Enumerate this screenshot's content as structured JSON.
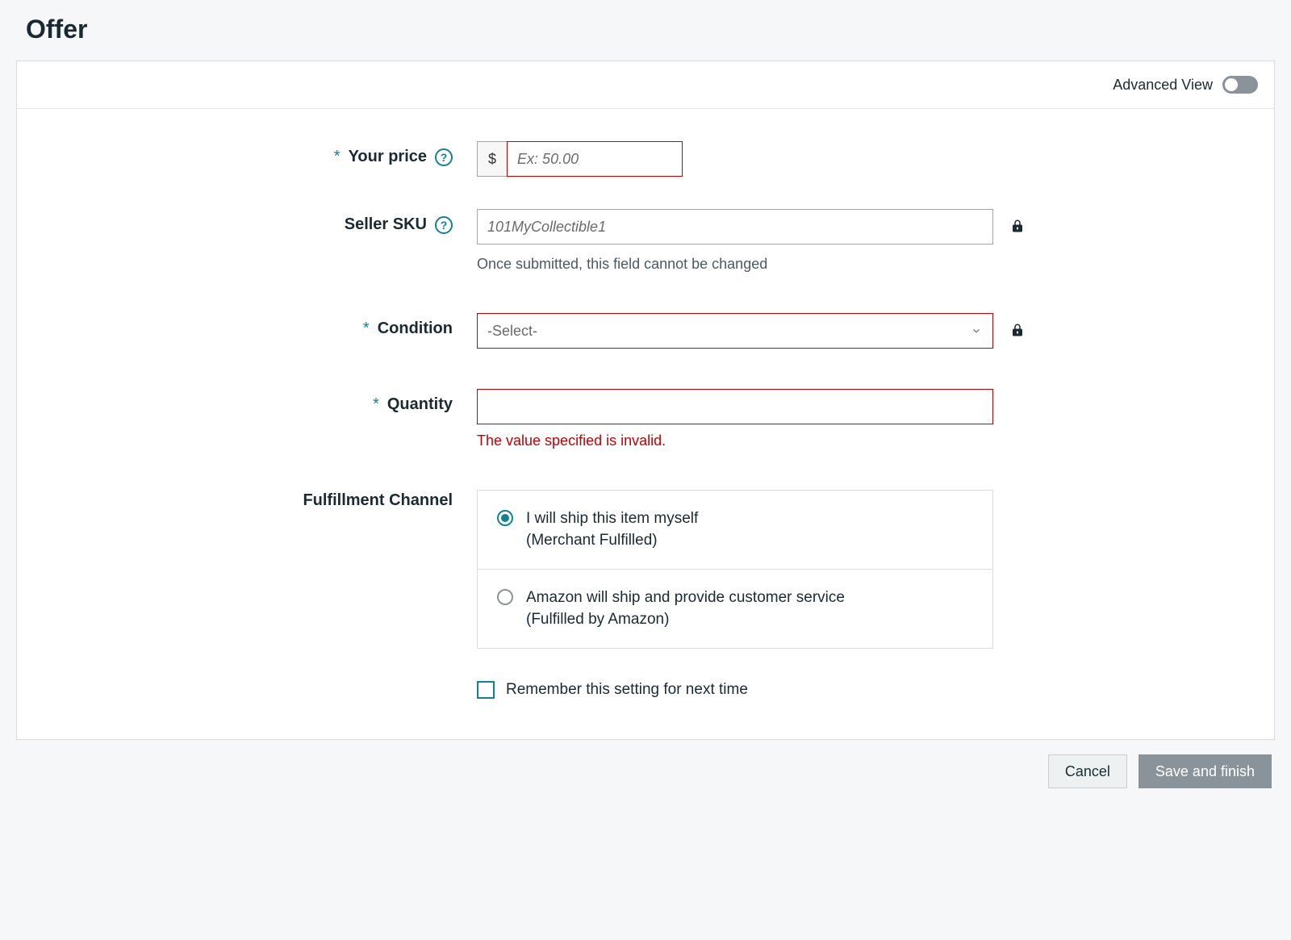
{
  "page": {
    "title": "Offer",
    "advanced_view_label": "Advanced View"
  },
  "fields": {
    "your_price": {
      "label": "Your price",
      "required_mark": "*",
      "currency_symbol": "$",
      "placeholder": "Ex: 50.00",
      "value": ""
    },
    "seller_sku": {
      "label": "Seller SKU",
      "placeholder": "101MyCollectible1",
      "value": "",
      "helper": "Once submitted, this field cannot be changed"
    },
    "condition": {
      "label": "Condition",
      "required_mark": "*",
      "selected_label": "-Select-"
    },
    "quantity": {
      "label": "Quantity",
      "required_mark": "*",
      "value": "",
      "error": "The value specified is invalid."
    },
    "fulfillment": {
      "label": "Fulfillment Channel",
      "options": [
        {
          "line1": "I will ship this item myself",
          "line2": "(Merchant Fulfilled)",
          "checked": true
        },
        {
          "line1": "Amazon will ship and provide customer service",
          "line2": "(Fulfilled by Amazon)",
          "checked": false
        }
      ],
      "remember_label": "Remember this setting for next time"
    }
  },
  "footer": {
    "cancel": "Cancel",
    "save": "Save and finish"
  }
}
